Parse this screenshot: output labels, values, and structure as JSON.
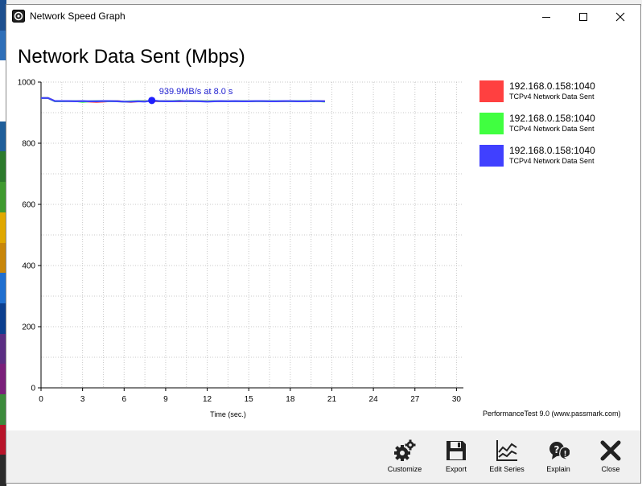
{
  "window": {
    "title": "Network Speed Graph",
    "app_icon": "passmark-icon"
  },
  "window_controls": {
    "minimize": "minimize-icon",
    "maximize": "maximize-icon",
    "close": "close-icon"
  },
  "graph": {
    "title": "Network Data Sent (Mbps)",
    "credit": "PerformanceTest 9.0 (www.passmark.com)"
  },
  "chart_data": {
    "type": "line",
    "title": "Network Data Sent (Mbps)",
    "xlabel": "Time (sec.)",
    "ylabel": "",
    "xlim": [
      0,
      30.5
    ],
    "ylim": [
      0,
      1000
    ],
    "x_ticks": [
      0,
      3,
      6,
      9,
      12,
      15,
      18,
      21,
      24,
      27,
      30
    ],
    "y_ticks": [
      0,
      200,
      400,
      600,
      800,
      1000
    ],
    "grid": true,
    "legend_position": "right",
    "highlight": {
      "series": 2,
      "x": 8.0,
      "y": 939.9,
      "label": "939.9MB/s at 8.0 s"
    },
    "series": [
      {
        "name": "192.168.0.158:1040",
        "subtitle": "TCPv4 Network Data Sent",
        "color": "#ff4040",
        "x": [
          0,
          0.5,
          1,
          1.5,
          2,
          2.5,
          3,
          3.5,
          4,
          4.5,
          5,
          5.5,
          6,
          6.5,
          7,
          7.5,
          8,
          8.5,
          9,
          9.5,
          10,
          10.5,
          11,
          11.5,
          12,
          12.5,
          13,
          13.5,
          14,
          14.5,
          15,
          15.5,
          16,
          16.5,
          17,
          17.5,
          18,
          18.5,
          19,
          19.5,
          20,
          20.5
        ],
        "y": [
          948,
          948,
          938,
          938,
          938,
          938,
          937,
          936,
          935,
          936,
          938,
          938,
          936,
          935,
          937,
          938,
          938,
          937,
          938,
          938,
          937,
          938,
          937,
          938,
          937,
          937,
          938,
          937,
          938,
          938,
          937,
          938,
          938,
          937,
          938,
          937,
          938,
          937,
          937,
          938,
          938,
          937
        ]
      },
      {
        "name": "192.168.0.158:1040",
        "subtitle": "TCPv4 Network Data Sent",
        "color": "#40ff40",
        "x": [
          0,
          0.5,
          1,
          1.5,
          2,
          2.5,
          3,
          3.5,
          4,
          4.5,
          5,
          5.5,
          6,
          6.5,
          7,
          7.5,
          8,
          8.5,
          9,
          9.5,
          10,
          10.5,
          11,
          11.5,
          12,
          12.5,
          13,
          13.5,
          14,
          14.5,
          15,
          15.5,
          16,
          16.5,
          17,
          17.5,
          18,
          18.5,
          19,
          19.5,
          20,
          20.5
        ],
        "y": [
          948,
          948,
          937,
          937,
          938,
          938,
          935,
          937,
          938,
          938,
          937,
          937,
          936,
          937,
          938,
          937,
          939,
          938,
          937,
          938,
          939,
          937,
          938,
          938,
          937,
          938,
          938,
          937,
          937,
          938,
          937,
          938,
          937,
          938,
          938,
          938,
          937,
          938,
          938,
          937,
          938,
          936
        ]
      },
      {
        "name": "192.168.0.158:1040",
        "subtitle": "TCPv4 Network Data Sent",
        "color": "#4040ff",
        "x": [
          0,
          0.5,
          1,
          1.5,
          2,
          2.5,
          3,
          3.5,
          4,
          4.5,
          5,
          5.5,
          6,
          6.5,
          7,
          7.5,
          8,
          8.5,
          9,
          9.5,
          10,
          10.5,
          11,
          11.5,
          12,
          12.5,
          13,
          13.5,
          14,
          14.5,
          15,
          15.5,
          16,
          16.5,
          17,
          17.5,
          18,
          18.5,
          19,
          19.5,
          20,
          20.5
        ],
        "y": [
          948,
          948,
          938,
          938,
          938,
          937,
          938,
          937,
          937,
          938,
          938,
          937,
          936,
          936,
          937,
          936,
          939.9,
          938,
          937,
          937,
          938,
          938,
          938,
          937,
          936,
          937,
          938,
          937,
          938,
          937,
          937,
          938,
          938,
          937,
          937,
          938,
          938,
          937,
          937,
          938,
          938,
          937
        ]
      }
    ]
  },
  "toolbar": [
    {
      "label": "Customize",
      "icon": "gears-icon"
    },
    {
      "label": "Export",
      "icon": "floppy-disk-icon"
    },
    {
      "label": "Edit Series",
      "icon": "line-chart-icon"
    },
    {
      "label": "Explain",
      "icon": "help-bubble-icon"
    },
    {
      "label": "Close",
      "icon": "close-x-icon"
    }
  ]
}
